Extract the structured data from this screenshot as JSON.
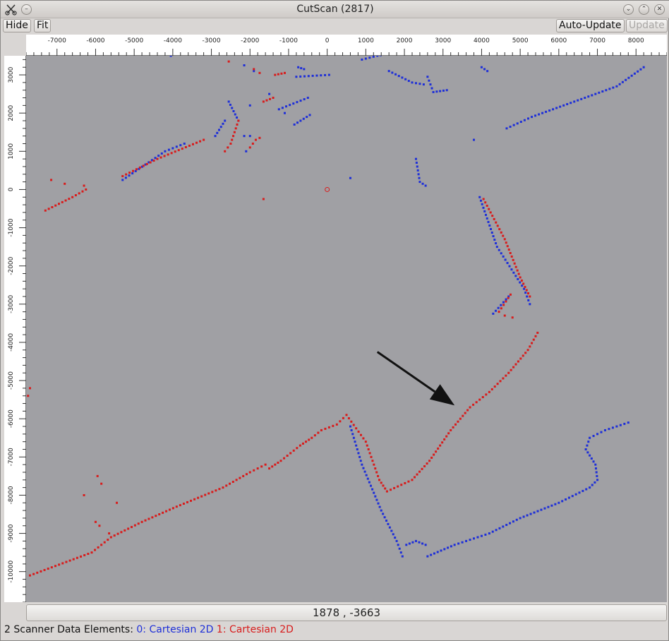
{
  "window": {
    "title": "CutScan (2817)",
    "app_icon": "scissors-icon"
  },
  "toolbar": {
    "hide_label": "Hide",
    "fit_label": "Fit",
    "auto_update_label": "Auto-Update",
    "update_label": "Update"
  },
  "coordinates": "1878 , -3663",
  "status": {
    "prefix": "2 Scanner Data Elements:",
    "element0": "0: Cartesian 2D",
    "element1": "1: Cartesian 2D"
  },
  "colors": {
    "series0": "#1e2fd8",
    "series1": "#d81c1c",
    "plot_bg": "#a0a0a4"
  },
  "chart_data": {
    "type": "scatter",
    "xlim": [
      -7800,
      8800
    ],
    "ylim": [
      -10800,
      3500
    ],
    "x_ticks": [
      -7000,
      -6000,
      -5000,
      -4000,
      -3000,
      -2000,
      -1000,
      0,
      1000,
      2000,
      3000,
      4000,
      5000,
      6000,
      7000,
      8000
    ],
    "y_ticks": [
      3000,
      2000,
      1000,
      0,
      -1000,
      -2000,
      -3000,
      -4000,
      -5000,
      -6000,
      -7000,
      -8000,
      -9000,
      -10000
    ],
    "series": [
      {
        "name": "0: Cartesian 2D",
        "color": "#1e2fd8",
        "strokes": [
          [
            [
              -5300,
              250
            ],
            [
              -4200,
              1000
            ],
            [
              -3700,
              1200
            ]
          ],
          [
            [
              -2550,
              2300
            ],
            [
              -2300,
              1800
            ]
          ],
          [
            [
              -2650,
              1800
            ],
            [
              -2900,
              1400
            ]
          ],
          [
            [
              -1250,
              2100
            ],
            [
              -500,
              2400
            ]
          ],
          [
            [
              -850,
              1700
            ],
            [
              -450,
              1950
            ]
          ],
          [
            [
              -800,
              2950
            ],
            [
              50,
              3000
            ]
          ],
          [
            [
              -750,
              3200
            ],
            [
              -600,
              3150
            ]
          ],
          [
            [
              900,
              3400
            ],
            [
              1300,
              3500
            ],
            [
              1550,
              3550
            ]
          ],
          [
            [
              1600,
              3100
            ],
            [
              2200,
              2800
            ],
            [
              2500,
              2750
            ]
          ],
          [
            [
              2600,
              2950
            ],
            [
              2750,
              2550
            ],
            [
              3100,
              2600
            ]
          ],
          [
            [
              2300,
              800
            ],
            [
              2400,
              200
            ],
            [
              2550,
              100
            ]
          ],
          [
            [
              4000,
              3200
            ],
            [
              4150,
              3100
            ]
          ],
          [
            [
              4650,
              1600
            ],
            [
              5300,
              1900
            ],
            [
              6400,
              2300
            ],
            [
              7500,
              2700
            ],
            [
              8200,
              3200
            ]
          ],
          [
            [
              3950,
              -200
            ],
            [
              4400,
              -1500
            ],
            [
              5100,
              -2600
            ],
            [
              5250,
              -3000
            ]
          ],
          [
            [
              4300,
              -3250
            ],
            [
              4700,
              -2800
            ]
          ],
          [
            [
              600,
              -6200
            ],
            [
              900,
              -7200
            ],
            [
              1400,
              -8400
            ],
            [
              1800,
              -9200
            ],
            [
              1950,
              -9600
            ]
          ],
          [
            [
              2050,
              -9300
            ],
            [
              2300,
              -9200
            ],
            [
              2550,
              -9300
            ]
          ],
          [
            [
              2600,
              -9600
            ],
            [
              3300,
              -9300
            ],
            [
              4200,
              -9000
            ],
            [
              5000,
              -8600
            ],
            [
              6000,
              -8200
            ],
            [
              6800,
              -7800
            ],
            [
              7000,
              -7600
            ],
            [
              6950,
              -7200
            ],
            [
              6700,
              -6800
            ],
            [
              6800,
              -6500
            ],
            [
              7200,
              -6300
            ],
            [
              7800,
              -6100
            ]
          ]
        ],
        "points": [
          [
            -4050,
            3500
          ],
          [
            -2150,
            3250
          ],
          [
            -1900,
            3100
          ],
          [
            -2000,
            2200
          ],
          [
            -1500,
            2500
          ],
          [
            -1100,
            2000
          ],
          [
            600,
            300
          ],
          [
            3800,
            1300
          ],
          [
            -2150,
            1400
          ],
          [
            -2000,
            1400
          ],
          [
            -2100,
            1000
          ]
        ]
      },
      {
        "name": "1: Cartesian 2D",
        "color": "#d81c1c",
        "strokes": [
          [
            [
              -5300,
              350
            ],
            [
              -4400,
              800
            ],
            [
              -3200,
              1300
            ]
          ],
          [
            [
              -7300,
              -550
            ],
            [
              -6600,
              -200
            ],
            [
              -6250,
              0
            ]
          ],
          [
            [
              -2650,
              1000
            ],
            [
              -2500,
              1200
            ],
            [
              -2300,
              1800
            ]
          ],
          [
            [
              -1650,
              2300
            ],
            [
              -1400,
              2400
            ]
          ],
          [
            [
              -1350,
              3000
            ],
            [
              -1100,
              3050
            ]
          ],
          [
            [
              -2000,
              1100
            ],
            [
              -1850,
              1300
            ],
            [
              -1750,
              1350
            ]
          ],
          [
            [
              4050,
              -250
            ],
            [
              4600,
              -1300
            ],
            [
              5000,
              -2300
            ],
            [
              5250,
              -2800
            ]
          ],
          [
            [
              4450,
              -3200
            ],
            [
              4750,
              -2750
            ]
          ],
          [
            [
              -7700,
              -10100
            ],
            [
              -6100,
              -9500
            ],
            [
              -5600,
              -9100
            ],
            [
              -4800,
              -8700
            ],
            [
              -3900,
              -8300
            ],
            [
              -2700,
              -7800
            ],
            [
              -2000,
              -7400
            ],
            [
              -1600,
              -7200
            ],
            [
              -1500,
              -7300
            ],
            [
              -1200,
              -7100
            ],
            [
              -700,
              -6700
            ],
            [
              -400,
              -6500
            ],
            [
              -150,
              -6300
            ],
            [
              250,
              -6150
            ],
            [
              500,
              -5900
            ],
            [
              1000,
              -6600
            ],
            [
              1350,
              -7600
            ],
            [
              1550,
              -7900
            ],
            [
              2200,
              -7600
            ],
            [
              2650,
              -7100
            ],
            [
              3200,
              -6300
            ],
            [
              3700,
              -5700
            ],
            [
              4200,
              -5300
            ],
            [
              4700,
              -4800
            ],
            [
              5200,
              -4200
            ],
            [
              5450,
              -3750
            ]
          ]
        ],
        "points": [
          [
            -2950,
            3600
          ],
          [
            -2550,
            3350
          ],
          [
            -1900,
            3150
          ],
          [
            -1750,
            3050
          ],
          [
            -7150,
            250
          ],
          [
            -6800,
            150
          ],
          [
            -6300,
            100
          ],
          [
            -1650,
            -250
          ],
          [
            -7700,
            -5200
          ],
          [
            -7750,
            -5400
          ],
          [
            -6300,
            -8000
          ],
          [
            -5950,
            -7500
          ],
          [
            -5850,
            -7700
          ],
          [
            -6000,
            -8700
          ],
          [
            -5900,
            -8800
          ],
          [
            -5650,
            -9000
          ],
          [
            -5450,
            -8200
          ],
          [
            4600,
            -3300
          ],
          [
            4800,
            -3350
          ]
        ],
        "markers": [
          {
            "shape": "circle",
            "x": 0,
            "y": 0
          }
        ]
      }
    ],
    "annotations": [
      {
        "type": "arrow",
        "from": [
          1300,
          -4250
        ],
        "to": [
          3300,
          -5650
        ],
        "color": "#111111"
      }
    ],
    "grid": false,
    "legend": "status bar"
  }
}
